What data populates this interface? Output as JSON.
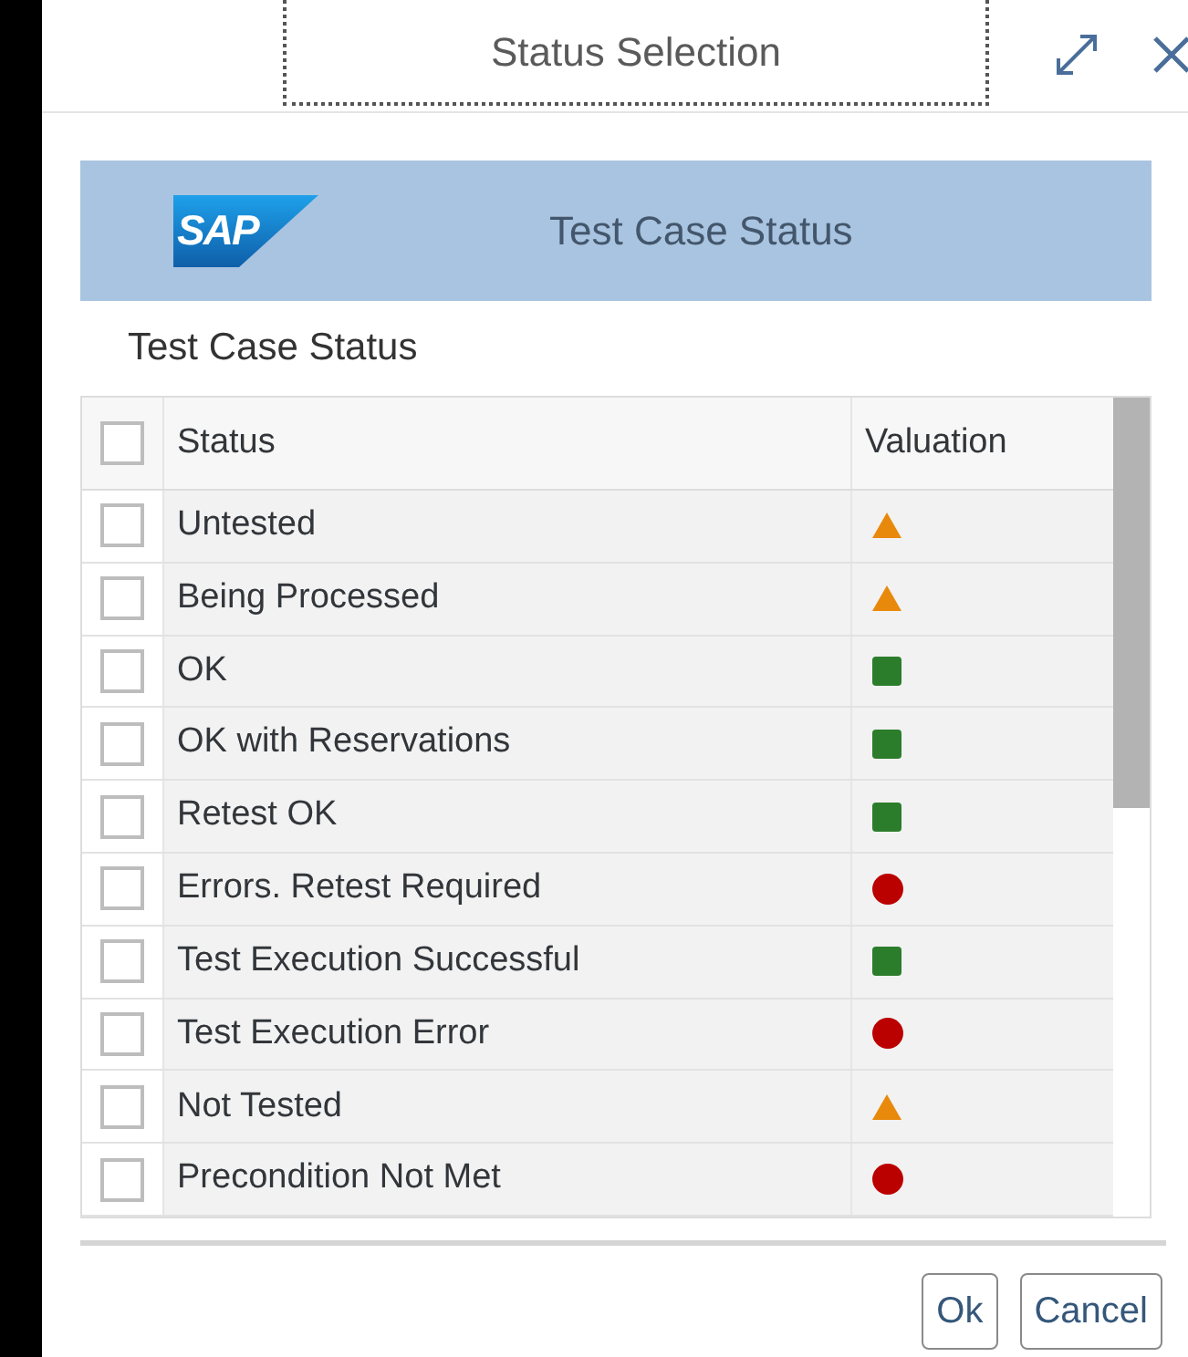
{
  "dialog": {
    "title": "Status Selection"
  },
  "banner": {
    "logo": "SAP",
    "title": "Test Case Status"
  },
  "section_title": "Test Case Status",
  "table": {
    "select_all_checked": false,
    "columns": [
      "Status",
      "Valuation"
    ],
    "rows": [
      {
        "label": "Untested",
        "checked": false,
        "kind": "triangle",
        "color": "#e8890c"
      },
      {
        "label": "Being Processed",
        "checked": false,
        "kind": "triangle",
        "color": "#e8890c"
      },
      {
        "label": "OK",
        "checked": false,
        "kind": "square",
        "color": "#2b7d2b"
      },
      {
        "label": "OK with Reservations",
        "checked": false,
        "kind": "square",
        "color": "#2b7d2b"
      },
      {
        "label": "Retest OK",
        "checked": false,
        "kind": "square",
        "color": "#2b7d2b"
      },
      {
        "label": "Errors. Retest Required",
        "checked": false,
        "kind": "circle",
        "color": "#bb0000"
      },
      {
        "label": "Test Execution Successful",
        "checked": false,
        "kind": "square",
        "color": "#2b7d2b"
      },
      {
        "label": "Test Execution Error",
        "checked": false,
        "kind": "circle",
        "color": "#bb0000"
      },
      {
        "label": "Not Tested",
        "checked": false,
        "kind": "triangle",
        "color": "#e8890c"
      },
      {
        "label": "Precondition Not Met",
        "checked": false,
        "kind": "circle",
        "color": "#bb0000"
      }
    ]
  },
  "buttons": [
    "Ok",
    "Cancel"
  ]
}
